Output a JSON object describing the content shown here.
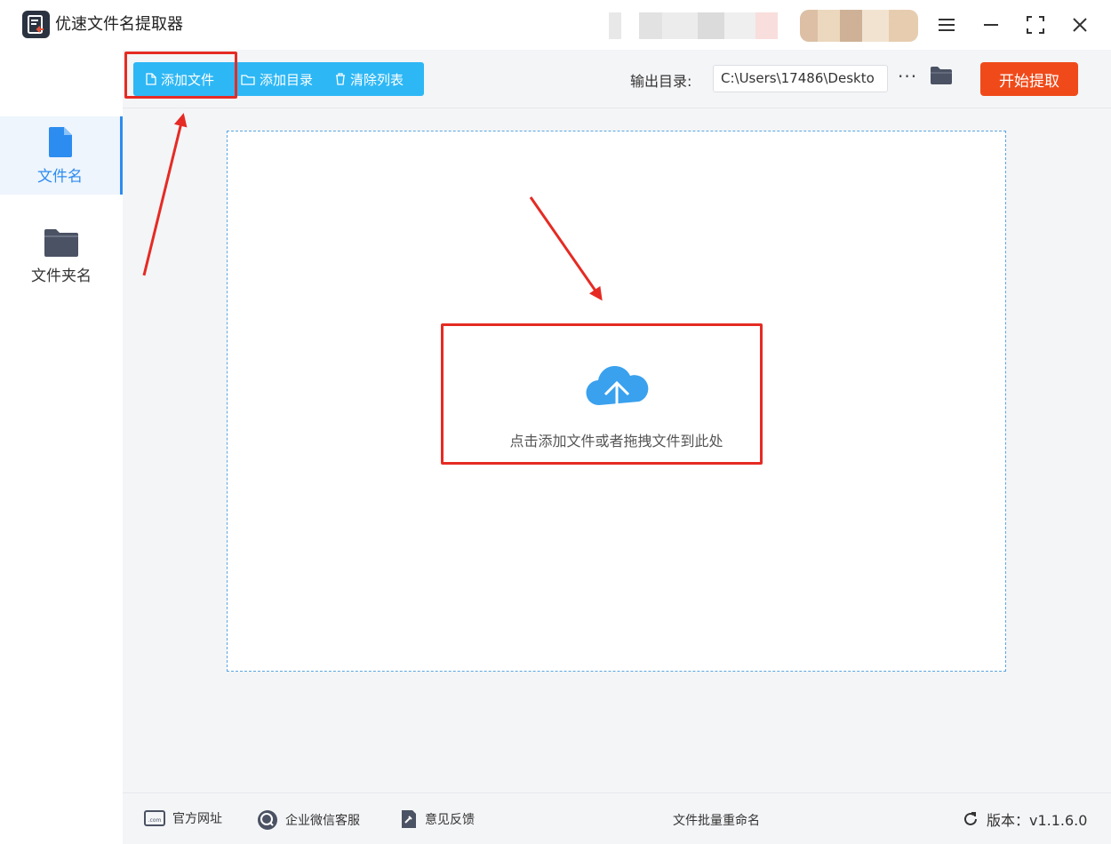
{
  "titlebar": {
    "title": "优速文件名提取器",
    "icons": [
      "app-logo",
      "menu-icon",
      "minimize-icon",
      "maximize-icon",
      "close-icon"
    ]
  },
  "sidebar": {
    "items": [
      {
        "label": "文件名",
        "icon": "file-icon",
        "active": true
      },
      {
        "label": "文件夹名",
        "icon": "folder-icon",
        "active": false
      }
    ]
  },
  "toolbar": {
    "add_file": "添加文件",
    "add_dir": "添加目录",
    "clear_list": "清除列表",
    "output_label": "输出目录:",
    "output_path": "C:\\Users\\17486\\Deskto",
    "more": "···",
    "start": "开始提取"
  },
  "dropzone": {
    "text": "点击添加文件或者拖拽文件到此处",
    "icon": "cloud-upload-icon"
  },
  "footer": {
    "website": "官方网址",
    "wechat": "企业微信客服",
    "feedback": "意见反馈",
    "center": "文件批量重命名",
    "version": "版本：v1.1.6.0"
  },
  "colors": {
    "accent": "#2d8cf0",
    "toolbar_btn": "#2db7f5",
    "start_btn": "#f04a1a",
    "highlight": "#e52b24"
  }
}
